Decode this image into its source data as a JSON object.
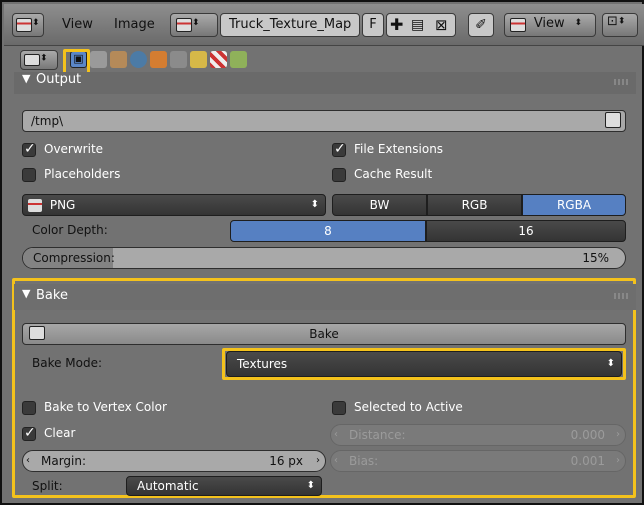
{
  "header": {
    "view_menu": "View",
    "image_menu": "Image",
    "image_name": "Truck_Texture_Map",
    "fake_user": "F",
    "view_mode": "View"
  },
  "context_tabs": [
    "render-tab",
    "render-layers-tab",
    "scene-tab",
    "world-tab",
    "object-tab",
    "constraints-tab",
    "modifiers-tab",
    "texture-tab",
    "material-tab"
  ],
  "output": {
    "title": "Output",
    "path": "/tmp\\",
    "overwrite": "Overwrite",
    "file_extensions": "File Extensions",
    "placeholders": "Placeholders",
    "cache_result": "Cache Result",
    "format": "PNG",
    "bw": "BW",
    "rgb": "RGB",
    "rgba": "RGBA",
    "color_depth_label": "Color Depth:",
    "depth_8": "8",
    "depth_16": "16",
    "compression_label": "Compression:",
    "compression_value": "15%",
    "compression_fraction": 0.15
  },
  "bake": {
    "title": "Bake",
    "bake_button": "Bake",
    "bake_mode_label": "Bake Mode:",
    "bake_mode_value": "Textures",
    "bake_to_vertex_color": "Bake to Vertex Color",
    "selected_to_active": "Selected to Active",
    "clear": "Clear",
    "distance_label": "Distance:",
    "distance_value": "0.000",
    "margin_label": "Margin:",
    "margin_value": "16 px",
    "bias_label": "Bias:",
    "bias_value": "0.001",
    "split_label": "Split:",
    "split_value": "Automatic"
  },
  "colors": {
    "highlight": "#f4c21c",
    "selected_blue": "#5680c2"
  }
}
